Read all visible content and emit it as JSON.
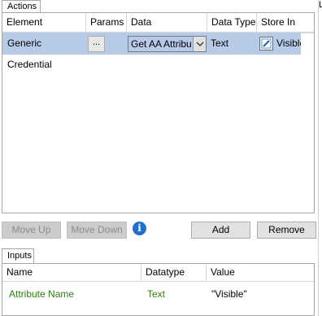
{
  "top_right_mark": "L",
  "actions_tab": {
    "label": "Actions"
  },
  "actions_grid": {
    "columns": [
      "Element",
      "Params",
      "Data",
      "Data Type",
      "Store In"
    ],
    "row": {
      "element": "Generic Credential",
      "params_button": "...",
      "data_value": "Get AA Attribu",
      "data_type": "Text",
      "store_in": "Visible"
    }
  },
  "toolbar": {
    "move_up": "Move Up",
    "move_down": "Move Down",
    "info_glyph": "i",
    "add": "Add",
    "remove": "Remove"
  },
  "inputs_tab": {
    "label": "Inputs"
  },
  "inputs_grid": {
    "columns": [
      "Name",
      "Datatype",
      "Value"
    ],
    "row": {
      "name": "Attribute Name",
      "datatype": "Text",
      "value": "\"Visible\""
    }
  },
  "colors": {
    "selection": "#b7cbe8",
    "green_text": "#2e7d12",
    "info_icon": "#1f6fd1"
  }
}
